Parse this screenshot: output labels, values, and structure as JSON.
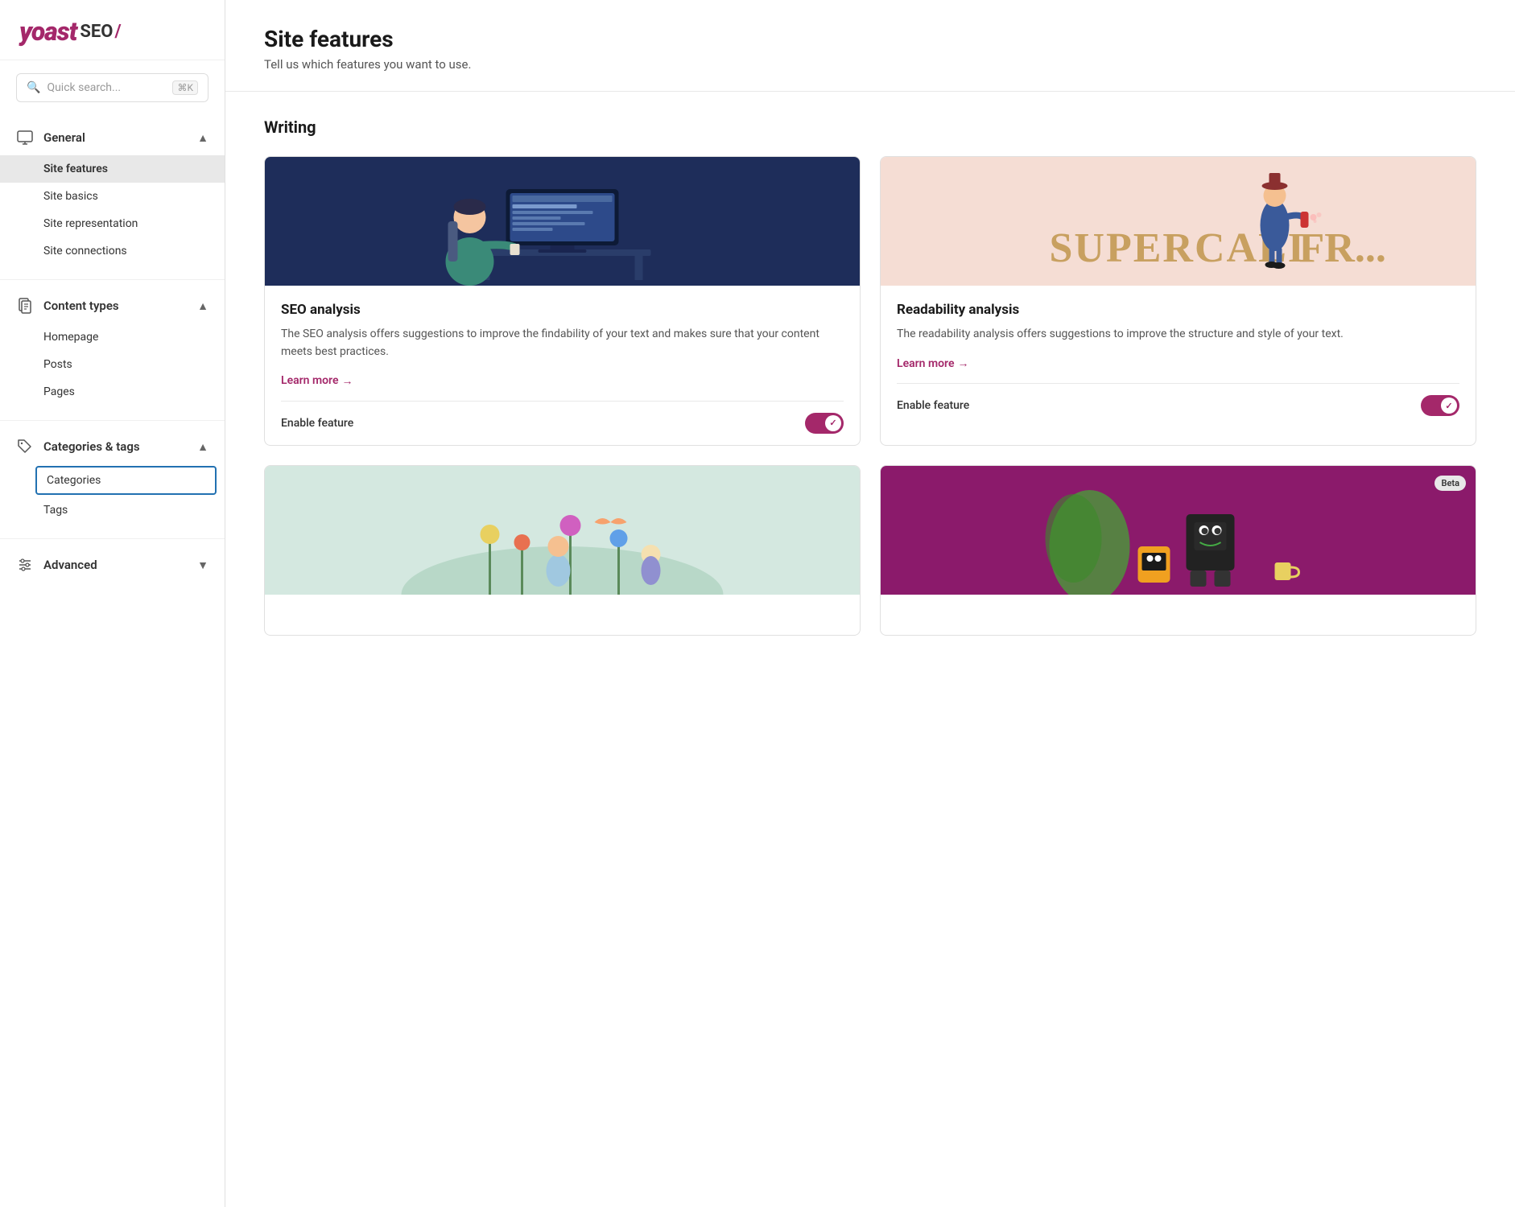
{
  "logo": {
    "yoast": "yoast",
    "seo": "SEO",
    "slash": "/"
  },
  "search": {
    "placeholder": "Quick search...",
    "shortcut": "⌘K"
  },
  "sidebar": {
    "sections": [
      {
        "id": "general",
        "icon": "monitor",
        "title": "General",
        "expanded": true,
        "items": [
          {
            "id": "site-features",
            "label": "Site features",
            "active": true,
            "selectedBlue": false
          },
          {
            "id": "site-basics",
            "label": "Site basics",
            "active": false,
            "selectedBlue": false
          },
          {
            "id": "site-representation",
            "label": "Site representation",
            "active": false,
            "selectedBlue": false
          },
          {
            "id": "site-connections",
            "label": "Site connections",
            "active": false,
            "selectedBlue": false
          }
        ]
      },
      {
        "id": "content-types",
        "icon": "document",
        "title": "Content types",
        "expanded": true,
        "items": [
          {
            "id": "homepage",
            "label": "Homepage",
            "active": false,
            "selectedBlue": false
          },
          {
            "id": "posts",
            "label": "Posts",
            "active": false,
            "selectedBlue": false
          },
          {
            "id": "pages",
            "label": "Pages",
            "active": false,
            "selectedBlue": false
          }
        ]
      },
      {
        "id": "categories-tags",
        "icon": "tag",
        "title": "Categories & tags",
        "expanded": true,
        "items": [
          {
            "id": "categories",
            "label": "Categories",
            "active": false,
            "selectedBlue": true
          },
          {
            "id": "tags",
            "label": "Tags",
            "active": false,
            "selectedBlue": false
          }
        ]
      },
      {
        "id": "advanced",
        "icon": "sliders",
        "title": "Advanced",
        "expanded": false,
        "items": []
      }
    ]
  },
  "page": {
    "title": "Site features",
    "subtitle": "Tell us which features you want to use.",
    "writing_section": "Writing"
  },
  "cards": [
    {
      "id": "seo-analysis",
      "title": "SEO analysis",
      "description": "The SEO analysis offers suggestions to improve the findability of your text and makes sure that your content meets best practices.",
      "learn_more": "Learn more",
      "arrow": "→",
      "enable_label": "Enable feature",
      "enabled": true,
      "beta": false,
      "image_type": "seo"
    },
    {
      "id": "readability-analysis",
      "title": "Readability analysis",
      "description": "The readability analysis offers suggestions to improve the structure and style of your text.",
      "learn_more": "Learn more",
      "arrow": "→",
      "enable_label": "Enable feature",
      "enabled": true,
      "beta": false,
      "image_type": "readability"
    },
    {
      "id": "card-three",
      "title": "",
      "description": "",
      "learn_more": "",
      "arrow": "",
      "enable_label": "",
      "enabled": false,
      "beta": false,
      "image_type": "third"
    },
    {
      "id": "card-four",
      "title": "",
      "description": "",
      "learn_more": "",
      "arrow": "",
      "enable_label": "",
      "enabled": false,
      "beta": true,
      "image_type": "fourth"
    }
  ]
}
